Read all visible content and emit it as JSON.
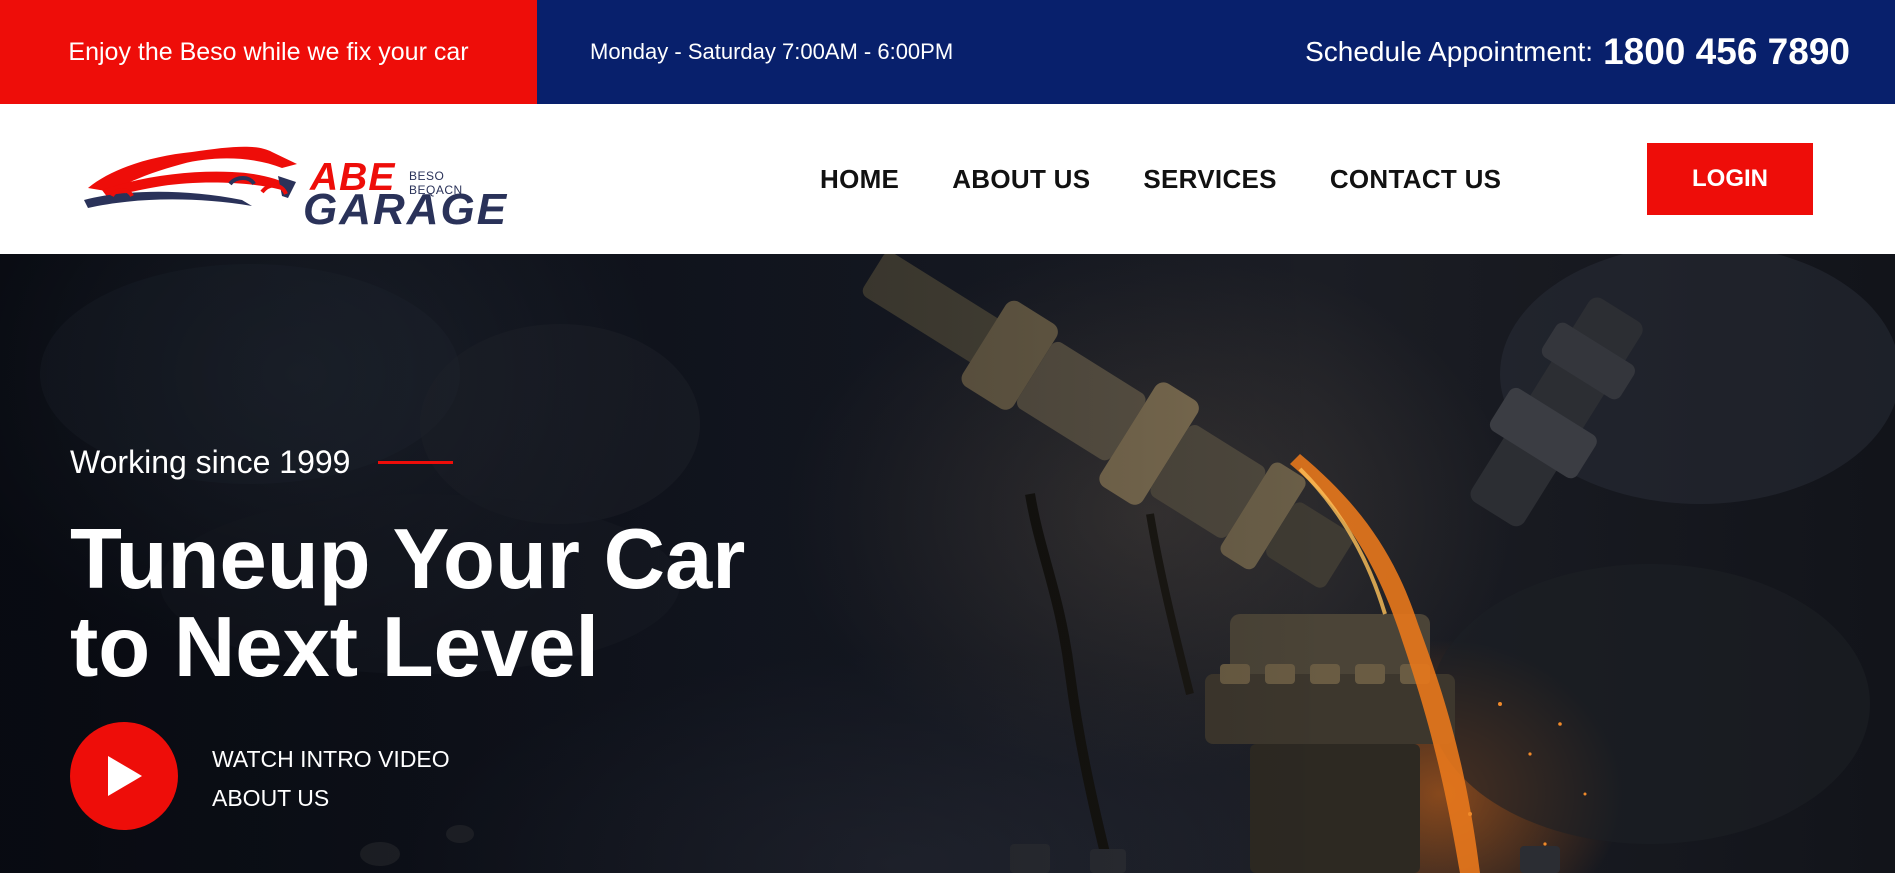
{
  "topbar": {
    "promo": "Enjoy the Beso while we fix your car",
    "hours": "Monday - Saturday 7:00AM - 6:00PM",
    "phone_label": "Schedule Appointment:",
    "phone_number": "1800 456 7890"
  },
  "logo": {
    "abe": "ABE",
    "subtitle": "BESO BEQACN",
    "garage": "GARAGE"
  },
  "nav": {
    "items": [
      {
        "label": "HOME"
      },
      {
        "label": "ABOUT US"
      },
      {
        "label": "SERVICES"
      },
      {
        "label": "CONTACT US"
      }
    ],
    "login_label": "LOGIN"
  },
  "hero": {
    "tagline": "Working since 1999",
    "title_line1": "Tuneup Your Car",
    "title_line2": "to Next Level",
    "video_line1": "WATCH INTRO VIDEO",
    "video_line2": "ABOUT US",
    "play_icon": "play-icon"
  },
  "colors": {
    "accent_red": "#ee0d09",
    "navy": "#08206c",
    "logo_navy": "#2a3259",
    "white": "#ffffff"
  }
}
